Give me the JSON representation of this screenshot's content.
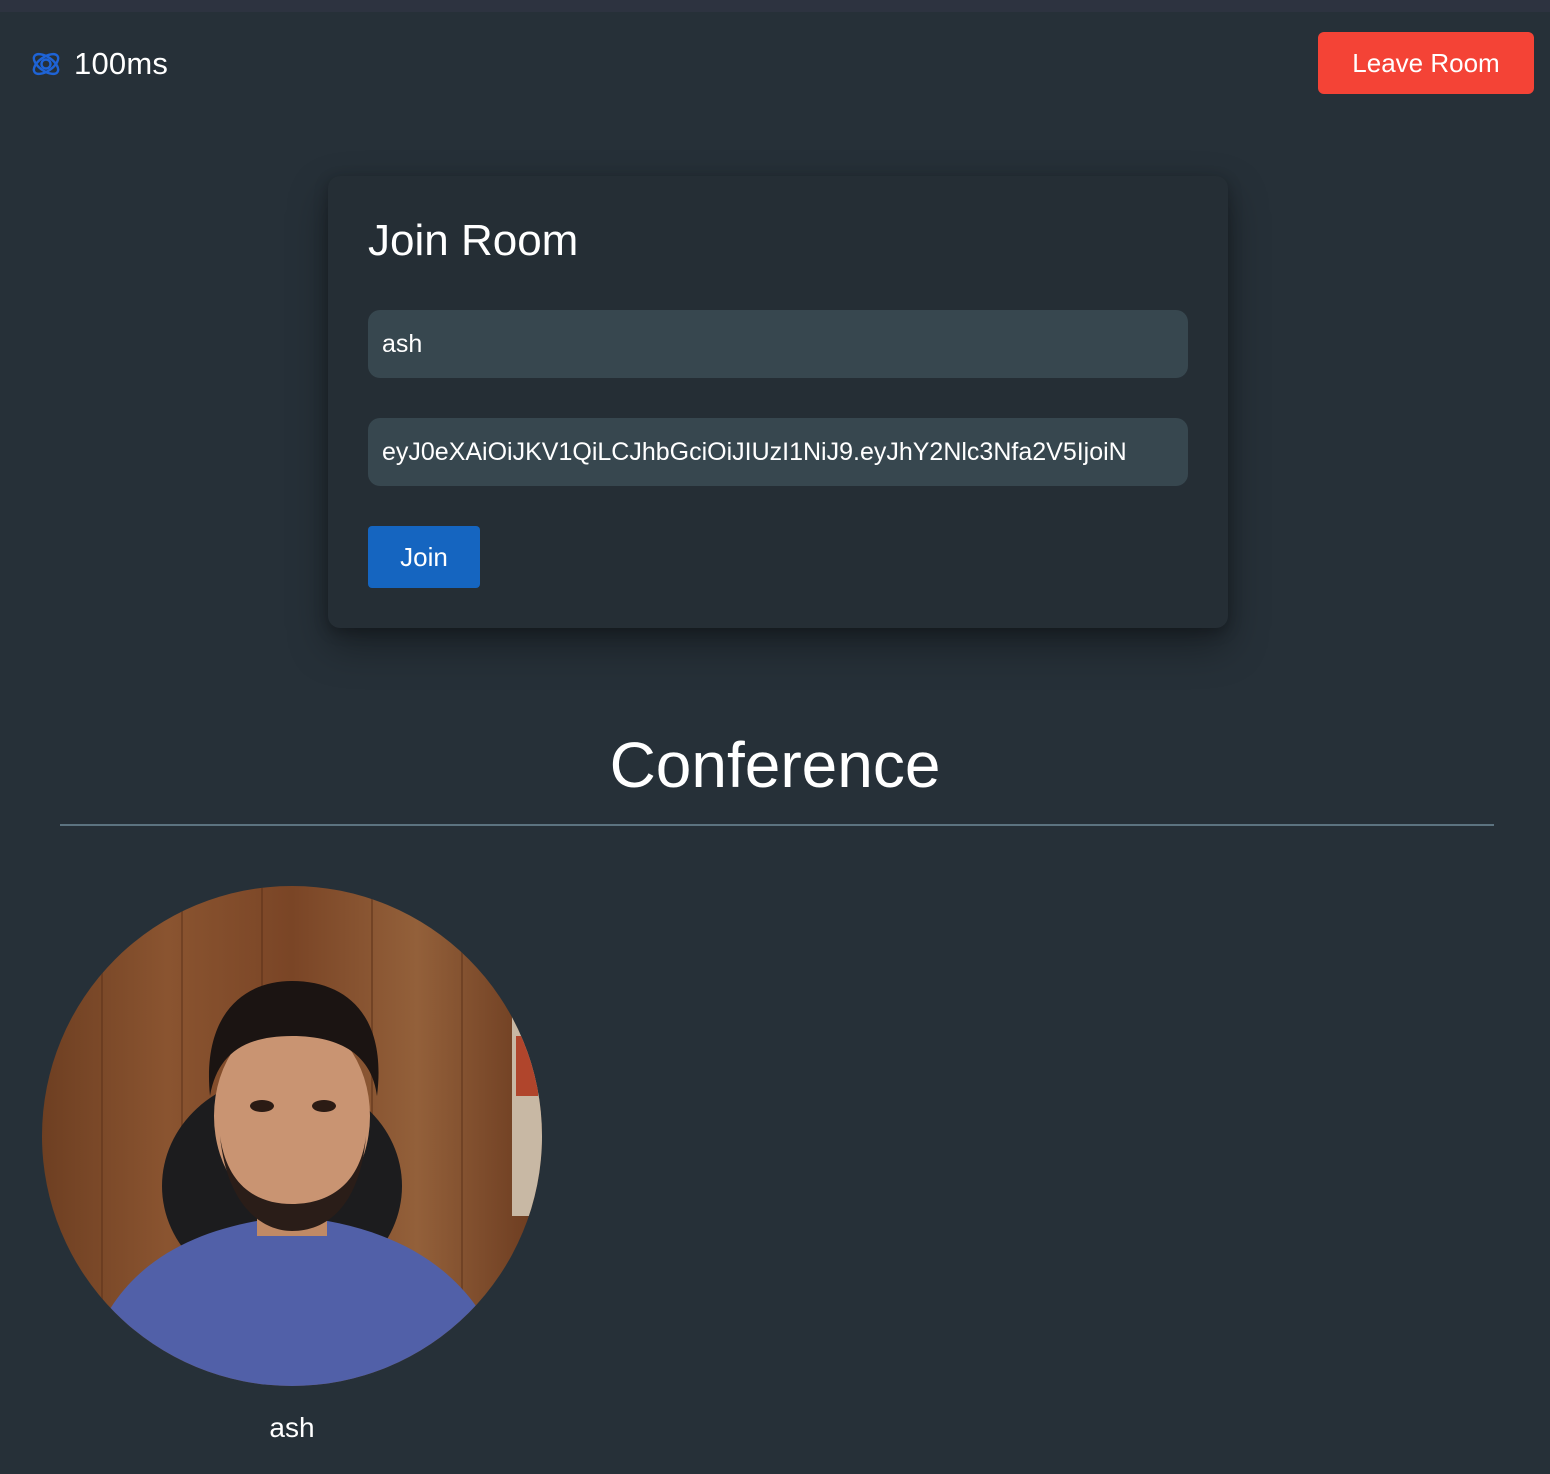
{
  "header": {
    "brand_name": "100ms",
    "leave_button_label": "Leave Room"
  },
  "join_form": {
    "title": "Join Room",
    "name_value": "ash",
    "token_value": "eyJ0eXAiOiJKV1QiLCJhbGciOiJIUzI1NiJ9.eyJhY2Nlc3Nfa2V5IjoiN",
    "join_button_label": "Join"
  },
  "conference": {
    "title": "Conference",
    "peers": [
      {
        "name": "ash"
      }
    ]
  },
  "colors": {
    "background": "#263038",
    "card": "#252e35",
    "input": "#37474f",
    "leave_button": "#f44336",
    "join_button": "#1565c0",
    "logo": "#1e63d6"
  }
}
